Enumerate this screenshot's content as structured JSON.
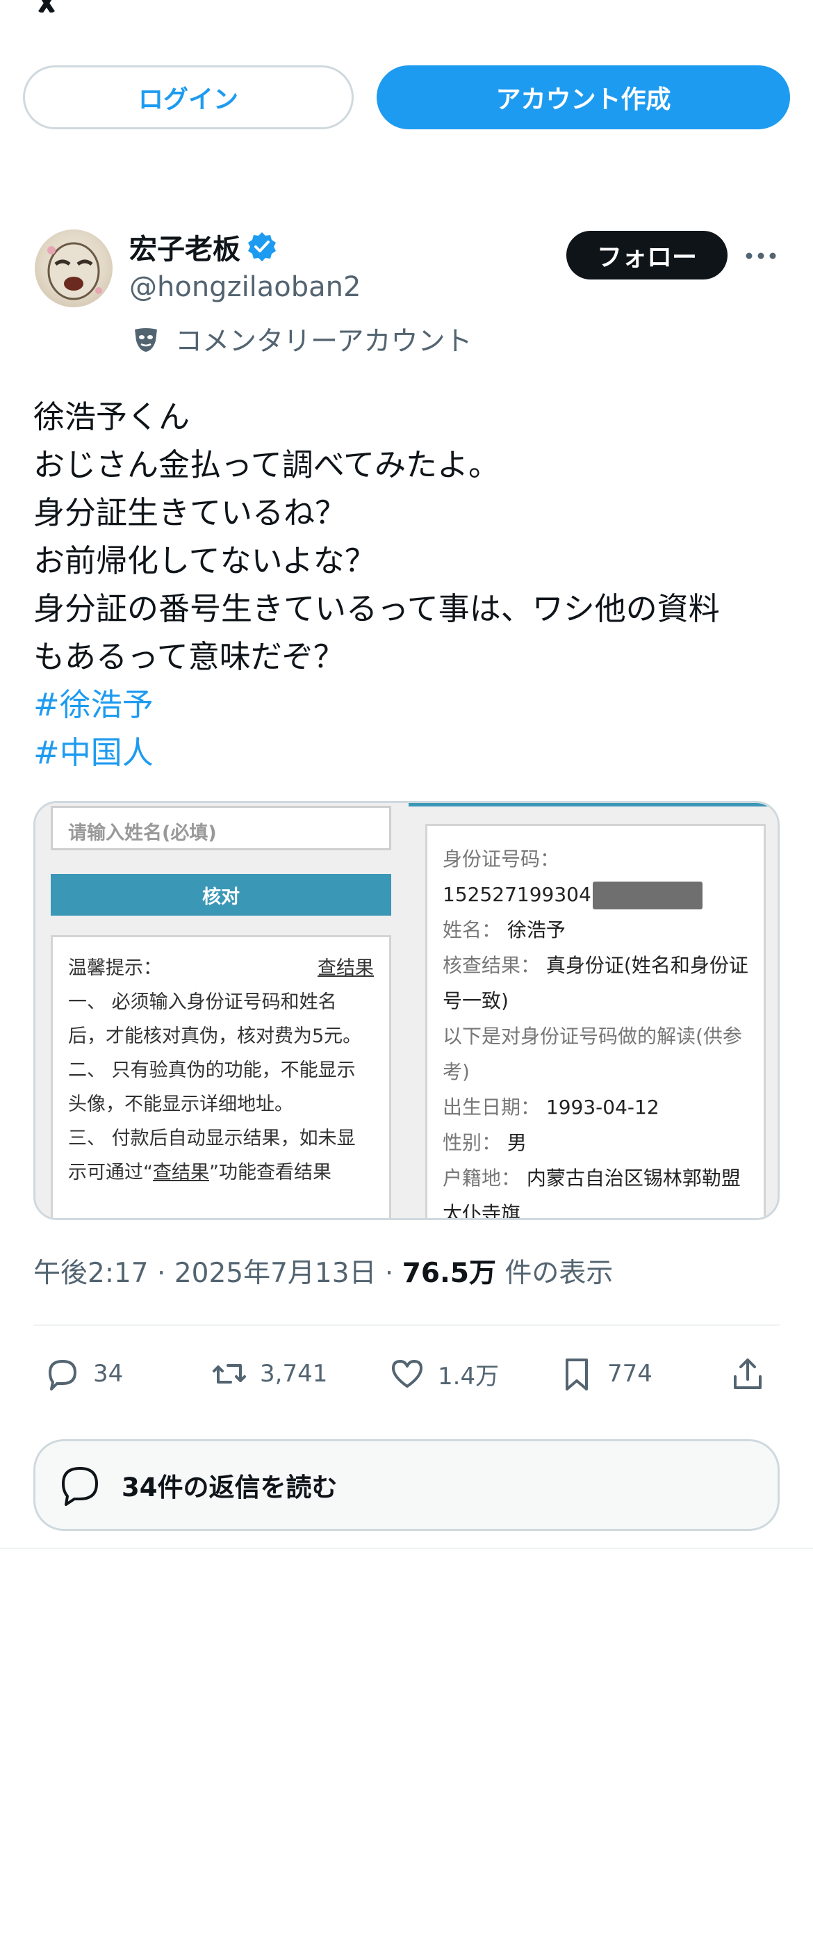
{
  "header": {
    "login_label": "ログイン",
    "signup_label": "アカウント作成"
  },
  "author": {
    "name": "宏子老板",
    "handle": "@hongzilaoban2",
    "commentary_label": "コメンタリーアカウント",
    "follow_label": "フォロー"
  },
  "tweet": {
    "lines": [
      "徐浩予くん",
      "おじさん金払って調べてみたよ。",
      "身分証生きているね？",
      "お前帰化してないよな？",
      "身分証の番号生きているって事は、ワシ他の資料",
      "もあるって意味だぞ？"
    ],
    "hashtags": [
      "#徐浩予",
      "#中国人"
    ]
  },
  "media": {
    "left": {
      "name_placeholder": "请输入姓名(必填)",
      "verify_label": "核对",
      "tips_title": "温馨提示：",
      "tips_link": "查结果",
      "tips": [
        "一、 必须输入身份证号码和姓名后，才能核对真伪，核对费为5元。",
        "二、 只有验真伪的功能，不能显示头像，不能显示详细地址。"
      ],
      "tip3_pre": "三、 付款后自动显示结果，如未显示可通过“",
      "tip3_link": "查结果",
      "tip3_post": "”功能查看结果"
    },
    "right": {
      "id_label": "身份证号码：",
      "id_number": "152527199304",
      "name_label": "姓名：",
      "name_value": "徐浩予",
      "result_label": "核查结果：",
      "result_value": "真身份证(姓名和身份证号一致)",
      "interpret_note": "以下是对身份证号码做的解读(供参考)",
      "dob_label": "出生日期：",
      "dob_value": "1993-04-12",
      "gender_label": "性别：",
      "gender_value": "男",
      "origin_label": "户籍地：",
      "origin_value": "内蒙古自治区锡林郭勒盟太仆寺旗"
    }
  },
  "meta": {
    "time": "午後2:17",
    "date": "2025年7月13日",
    "views_count": "76.5万",
    "views_label": "件の表示",
    "sep": "·"
  },
  "stats": {
    "replies": "34",
    "reposts": "3,741",
    "likes": "1.4万",
    "bookmarks": "774"
  },
  "read_replies_label": "34件の返信を読む",
  "colors": {
    "accent": "#1d9bf0",
    "text": "#0f1419",
    "muted": "#536471",
    "border": "#cfd9de"
  }
}
